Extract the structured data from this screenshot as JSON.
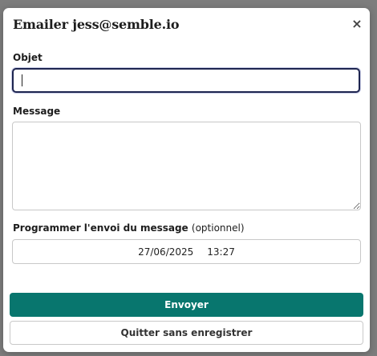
{
  "modal": {
    "title": "Emailer jess@semble.io",
    "close_glyph": "×"
  },
  "subject": {
    "label": "Objet",
    "value": "",
    "placeholder": ""
  },
  "message": {
    "label": "Message",
    "value": ""
  },
  "schedule": {
    "label": "Programmer l'envoi du message",
    "optional_label": "(optionnel)",
    "date": "27/06/2025",
    "time": "13:27"
  },
  "actions": {
    "send_label": "Envoyer",
    "quit_label": "Quitter sans enregistrer"
  },
  "colors": {
    "primary": "#08766e",
    "focus_border": "#1e2550"
  },
  "icons": {
    "close": "close-icon",
    "resize": "resize-grip-icon"
  }
}
